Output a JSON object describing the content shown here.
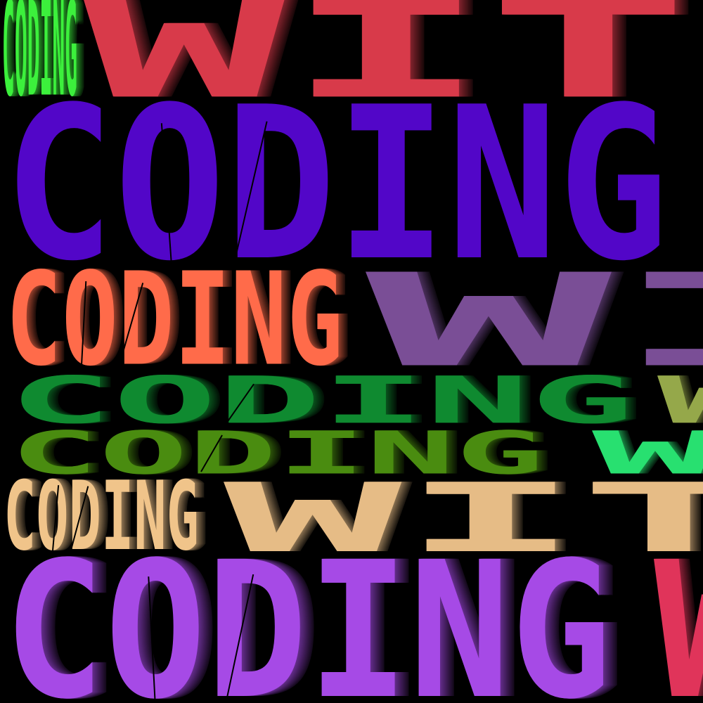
{
  "rows": [
    {
      "id": "row-1",
      "primary": "CODING",
      "secondary": "WITH",
      "primary_color": "#3cf03c",
      "secondary_color": "#d83a4a"
    },
    {
      "id": "row-2",
      "primary": "CODING",
      "secondary": "",
      "primary_color": "#5206c8",
      "secondary_color": ""
    },
    {
      "id": "row-3",
      "primary": "CODING",
      "secondary": "WI",
      "primary_color": "#ff6b4a",
      "secondary_color": "#7a4e96"
    },
    {
      "id": "row-4",
      "primary": "CODING",
      "secondary": "W",
      "primary_color": "#0f8a30",
      "secondary_color": "#95a84a"
    },
    {
      "id": "row-5",
      "primary": "CODING",
      "secondary": "W",
      "primary_color": "#4a8c10",
      "secondary_color": "#28e070"
    },
    {
      "id": "row-6",
      "primary": "CODING",
      "secondary": "WIT",
      "primary_color": "#f0c48a",
      "secondary_color": "#e6bc86"
    },
    {
      "id": "row-7",
      "primary": "CODING",
      "secondary": "W",
      "primary_color": "#a64ae6",
      "secondary_color": "#e0345a"
    }
  ]
}
